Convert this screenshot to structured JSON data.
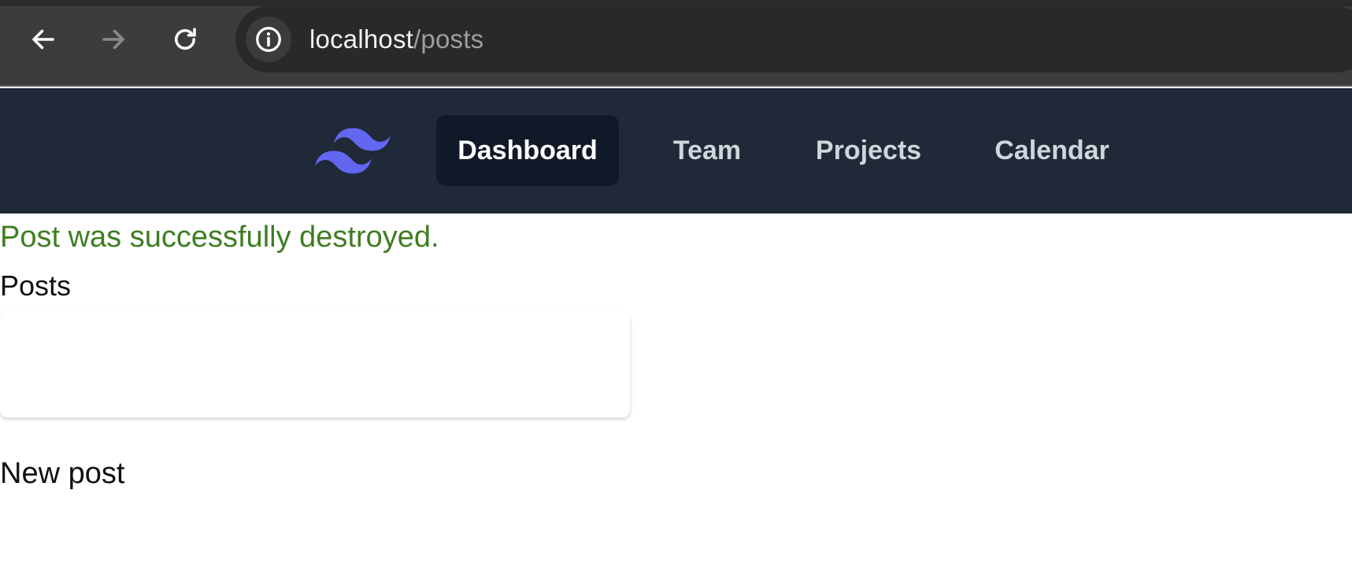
{
  "browser": {
    "url_host": "localhost",
    "url_path": "/posts",
    "icons": {
      "back": "arrow-left-icon",
      "forward": "arrow-right-icon",
      "reload": "reload-icon",
      "site_info": "info-icon"
    },
    "colors": {
      "chrome_bg": "#3c3c3c",
      "omnibox_bg": "#28292b",
      "host_text": "#f1f1f1",
      "path_text": "#9e9e9e"
    }
  },
  "navbar": {
    "logo": "tailwind-logo-icon",
    "items": [
      {
        "label": "Dashboard",
        "active": true
      },
      {
        "label": "Team",
        "active": false
      },
      {
        "label": "Projects",
        "active": false
      },
      {
        "label": "Calendar",
        "active": false
      }
    ],
    "colors": {
      "bg": "#1f2937",
      "active_bg": "#111827",
      "logo": "#6366f1"
    }
  },
  "main": {
    "notice": "Post was successfully destroyed.",
    "title": "Posts",
    "new_post_link": "New post",
    "colors": {
      "notice": "#3f7d22"
    }
  }
}
